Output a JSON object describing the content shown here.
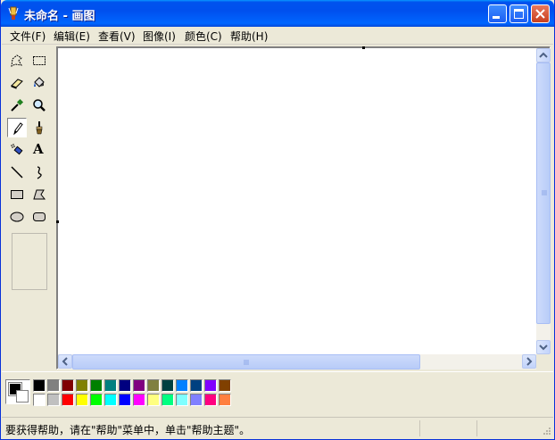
{
  "window": {
    "title": "未命名 - 画图"
  },
  "menu": [
    {
      "label": "文件(F)"
    },
    {
      "label": "编辑(E)"
    },
    {
      "label": "查看(V)"
    },
    {
      "label": "图像(I)"
    },
    {
      "label": "颜色(C)"
    },
    {
      "label": "帮助(H)"
    }
  ],
  "tools": [
    {
      "icon": "free-form-select-icon"
    },
    {
      "icon": "rect-select-icon"
    },
    {
      "icon": "eraser-icon"
    },
    {
      "icon": "fill-bucket-icon"
    },
    {
      "icon": "color-picker-icon"
    },
    {
      "icon": "magnifier-icon"
    },
    {
      "icon": "pencil-icon",
      "active": true
    },
    {
      "icon": "brush-icon"
    },
    {
      "icon": "airbrush-icon"
    },
    {
      "icon": "text-icon",
      "glyph": "A"
    },
    {
      "icon": "line-icon"
    },
    {
      "icon": "curve-icon"
    },
    {
      "icon": "rectangle-icon"
    },
    {
      "icon": "polygon-icon"
    },
    {
      "icon": "ellipse-icon"
    },
    {
      "icon": "rounded-rectangle-icon"
    }
  ],
  "colors": {
    "foreground": "#000000",
    "background": "#ffffff",
    "palette_top": [
      "#000000",
      "#808080",
      "#800000",
      "#808000",
      "#008000",
      "#008080",
      "#000080",
      "#800080",
      "#808040",
      "#004040",
      "#0080ff",
      "#004080",
      "#8000ff",
      "#804000"
    ],
    "palette_bottom": [
      "#ffffff",
      "#c0c0c0",
      "#ff0000",
      "#ffff00",
      "#00ff00",
      "#00ffff",
      "#0000ff",
      "#ff00ff",
      "#ffff80",
      "#00ff80",
      "#80ffff",
      "#8080ff",
      "#ff0080",
      "#ff8040"
    ]
  },
  "status": {
    "text": "要获得帮助，请在\"帮助\"菜单中，单击\"帮助主题\"。"
  }
}
